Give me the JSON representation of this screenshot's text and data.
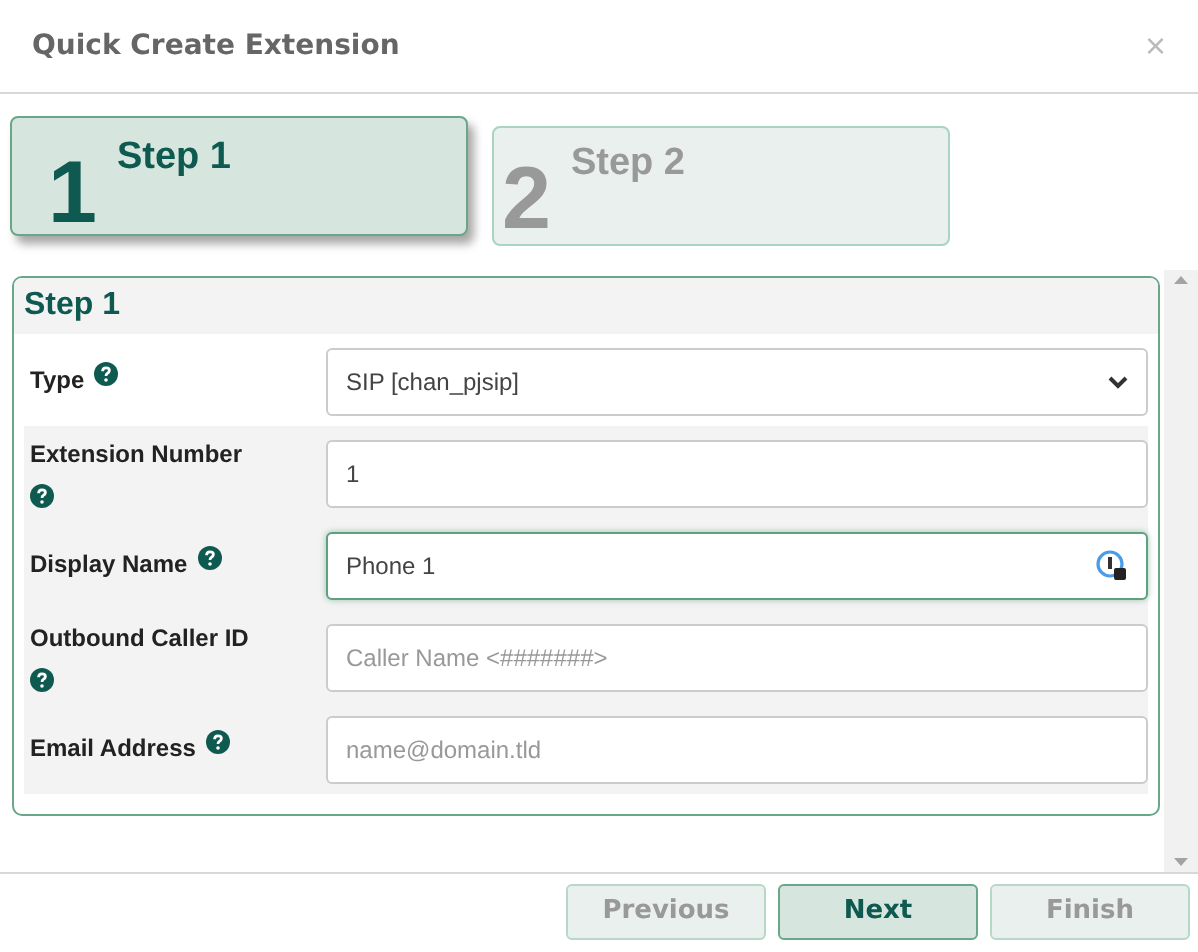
{
  "dialog": {
    "title": "Quick Create Extension",
    "close": "×"
  },
  "steps": [
    {
      "number": "1",
      "label": "Step 1",
      "selected": true
    },
    {
      "number": "2",
      "label": "Step 2",
      "selected": false
    }
  ],
  "section": {
    "title": "Step 1"
  },
  "fields": [
    {
      "kind": "select",
      "label": "Type",
      "value": "SIP [chan_pjsip]",
      "focused": false
    },
    {
      "kind": "text",
      "label": "Extension Number",
      "value": "1",
      "focused": false
    },
    {
      "kind": "text",
      "label": "Display Name",
      "value": "Phone 1",
      "focused": true
    },
    {
      "kind": "text",
      "label": "Outbound Caller ID",
      "placeholder": "Caller Name <#######>",
      "focused": false
    },
    {
      "kind": "text",
      "label": "Email Address",
      "placeholder": "name@domain.tld",
      "focused": false
    }
  ],
  "buttons": [
    {
      "label": "Previous",
      "disabled": true
    },
    {
      "label": "Next",
      "disabled": false
    },
    {
      "label": "Finish",
      "disabled": true
    }
  ]
}
